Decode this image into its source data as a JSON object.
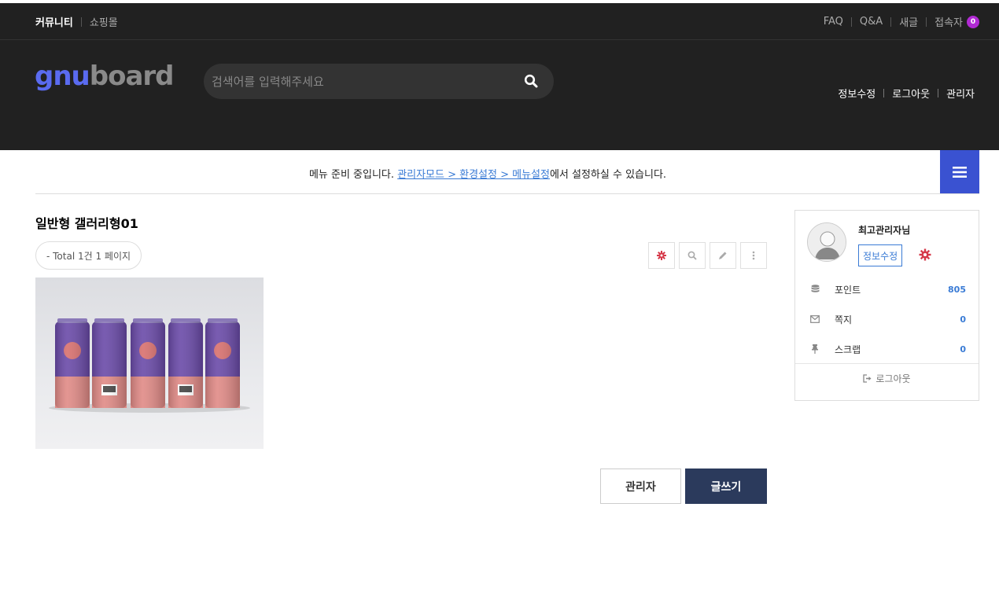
{
  "tnb": {
    "left_items": [
      "커뮤니티",
      "쇼핑몰"
    ],
    "right_items": [
      "FAQ",
      "Q&A",
      "새글"
    ],
    "visitors_label": "접속자",
    "visitors_count": "0"
  },
  "header": {
    "logo_part1": "gnu",
    "logo_part2": "board",
    "search_placeholder": "검색어를 입력해주세요",
    "links": [
      "정보수정",
      "로그아웃",
      "관리자"
    ]
  },
  "gnb": {
    "message_prefix": "메뉴 준비 중입니다. ",
    "message_link": "관리자모드 > 환경설정 > 메뉴설정",
    "message_suffix": "에서 설정하실 수 있습니다."
  },
  "board": {
    "title": "일반형 갤러리형01",
    "total_text": "- Total 1건 1 페이지",
    "admin_button": "관리자",
    "write_button": "글쓰기"
  },
  "outlogin": {
    "nickname": "최고관리자님",
    "edit_label": "정보수정",
    "rows": [
      {
        "label": "포인트",
        "value": "805",
        "icon": "database-icon"
      },
      {
        "label": "쪽지",
        "value": "0",
        "icon": "envelope-icon"
      },
      {
        "label": "스크랩",
        "value": "0",
        "icon": "pin-icon"
      }
    ],
    "logout_label": "로그아웃"
  },
  "colors": {
    "header_bg": "#212121",
    "accent_blue": "#3a52d1",
    "write_button_bg": "#2b3a5c",
    "badge": "#b12ad4",
    "gear_red": "#d63a4a",
    "link_blue": "#3a7bd5"
  }
}
